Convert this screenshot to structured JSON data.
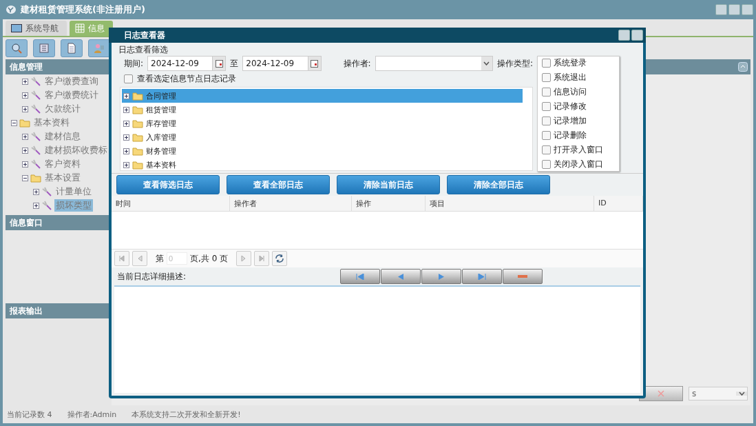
{
  "app": {
    "title": "建材租赁管理系统(非注册用户)",
    "tabs": [
      {
        "label": "系统导航",
        "selected": false
      },
      {
        "label": "信息",
        "selected": true
      }
    ],
    "sidebar": {
      "panels": [
        {
          "title": "信息管理",
          "tree_continued": [
            {
              "label": "客户缴费查询",
              "kind": "leaf",
              "selected": false
            },
            {
              "label": "客户缴费统计",
              "kind": "leaf",
              "selected": false
            },
            {
              "label": "欠款统计",
              "kind": "leaf",
              "selected": false
            }
          ],
          "tree": [
            {
              "label": "基本资料",
              "kind": "folder",
              "expanded": true,
              "selected": false,
              "children": [
                {
                  "label": "建材信息",
                  "kind": "leaf",
                  "selected": false
                },
                {
                  "label": "建材损坏收费标",
                  "kind": "leaf",
                  "selected": false
                },
                {
                  "label": "客户资料",
                  "kind": "leaf",
                  "selected": false
                },
                {
                  "label": "基本设置",
                  "kind": "folder",
                  "expanded": true,
                  "selected": false,
                  "children": [
                    {
                      "label": "计量单位",
                      "kind": "leaf",
                      "selected": false
                    },
                    {
                      "label": "损坏类型",
                      "kind": "leaf",
                      "selected": true
                    }
                  ]
                }
              ]
            }
          ]
        },
        {
          "title": "信息窗口"
        },
        {
          "title": "报表输出"
        }
      ]
    },
    "unit_select": {
      "value": "s"
    },
    "status_bar": [
      "当前记录数 4",
      "操作者:Admin",
      "本系统支持二次开发和全新开发!"
    ]
  },
  "log_viewer": {
    "title": "日志查看器",
    "filter": {
      "legend": "日志查看筛选",
      "period_label": "期间:",
      "from": "2024-12-09",
      "to_label": "至",
      "to": "2024-12-09",
      "operator_label": "操作者:",
      "operation_type_label": "操作类型:",
      "node_only": {
        "label": "查看选定信息节点日志记录",
        "checked": false
      },
      "tree": [
        {
          "label": "合同管理",
          "selected": true
        },
        {
          "label": "租赁管理",
          "selected": false
        },
        {
          "label": "库存管理",
          "selected": false
        },
        {
          "label": "入库管理",
          "selected": false
        },
        {
          "label": "财务管理",
          "selected": false
        },
        {
          "label": "基本资料",
          "selected": false
        }
      ],
      "operation_types": [
        {
          "label": "系统登录",
          "checked": false
        },
        {
          "label": "系统退出",
          "checked": false
        },
        {
          "label": "信息访问",
          "checked": false
        },
        {
          "label": "记录修改",
          "checked": false
        },
        {
          "label": "记录增加",
          "checked": false
        },
        {
          "label": "记录删除",
          "checked": false
        },
        {
          "label": "打开录入窗口",
          "checked": false
        },
        {
          "label": "关闭录入窗口",
          "checked": false
        }
      ]
    },
    "buttons": [
      "查看筛选日志",
      "查看全部日志",
      "清除当前日志",
      "清除全部日志"
    ],
    "table": {
      "columns": [
        "时间",
        "操作者",
        "操作",
        "项目",
        "ID"
      ]
    },
    "pager": {
      "page_label": "第",
      "page": "0",
      "total_label": "页,共 0 页"
    },
    "detail": {
      "label": "当前日志详细描述:"
    }
  }
}
